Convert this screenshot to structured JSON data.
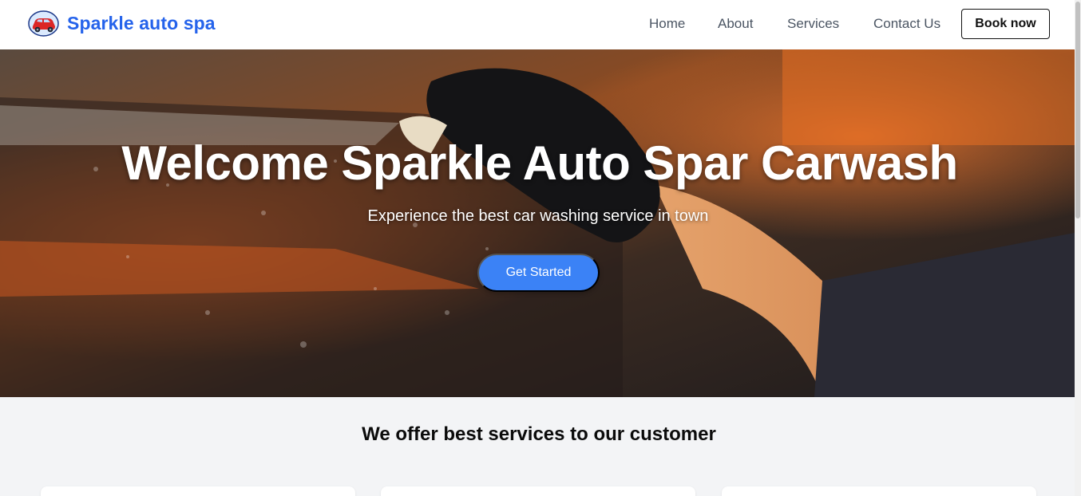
{
  "brand": {
    "name": "Sparkle auto spa",
    "logo_icon": "red-car-logo-icon"
  },
  "nav": {
    "links": [
      {
        "label": "Home"
      },
      {
        "label": "About"
      },
      {
        "label": "Services"
      },
      {
        "label": "Contact Us"
      }
    ],
    "book_button": "Book now"
  },
  "hero": {
    "title": "Welcome Sparkle Auto Spar Carwash",
    "subtitle": "Experience the best car washing service in town",
    "cta_label": "Get Started",
    "photo": "hand-in-black-glove-washing-car"
  },
  "services": {
    "heading": "We offer best services to our customer",
    "cards": [
      {},
      {},
      {}
    ]
  },
  "colors": {
    "brand": "#2563eb",
    "cta": "#3b82f6",
    "section_bg": "#f3f4f6"
  }
}
